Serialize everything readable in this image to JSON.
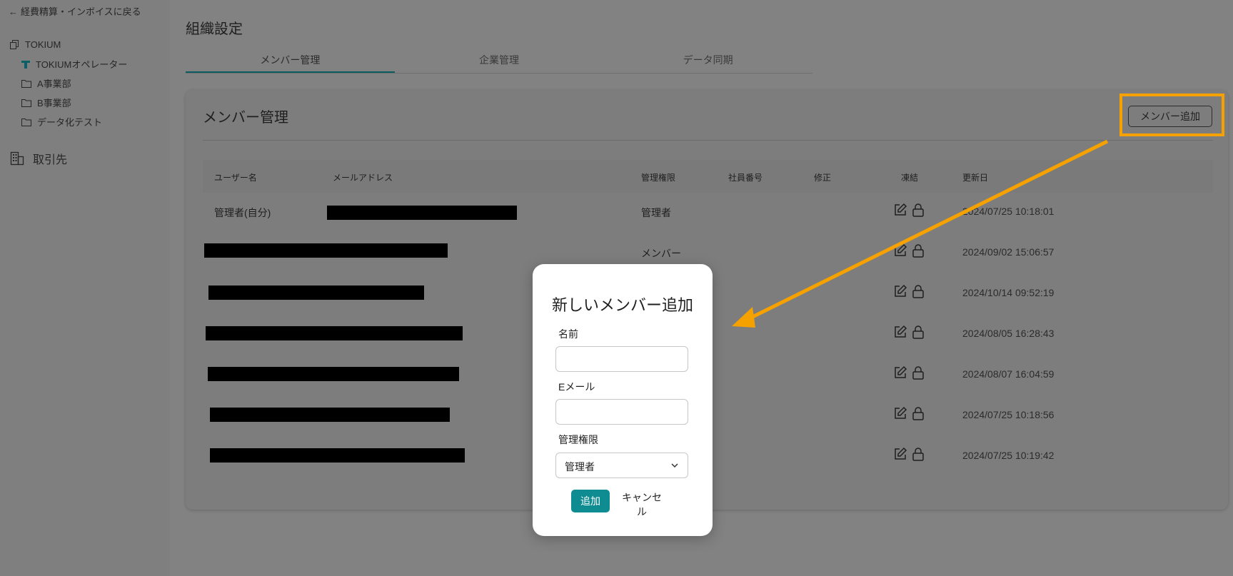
{
  "sidebar": {
    "back_link": "経費精算・インボイスに戻る",
    "org_root": "TOKIUM",
    "items": [
      {
        "label": "TOKIUMオペレーター"
      },
      {
        "label": "A事業部"
      },
      {
        "label": "B事業部"
      },
      {
        "label": "データ化テスト"
      }
    ],
    "vendor": "取引先"
  },
  "page": {
    "title": "組織設定",
    "tabs": [
      {
        "label": "メンバー管理",
        "active": true
      },
      {
        "label": "企業管理",
        "active": false
      },
      {
        "label": "データ同期",
        "active": false
      }
    ]
  },
  "card": {
    "title": "メンバー管理",
    "add_button": "メンバー追加",
    "columns": [
      "ユーザー名",
      "メールアドレス",
      "管理権限",
      "社員番号",
      "修正",
      "凍結",
      "更新日"
    ],
    "rows": [
      {
        "name": "管理者(自分)",
        "role": "管理者",
        "updated": "2024/07/25 10:18:01"
      },
      {
        "name": "",
        "role": "メンバー",
        "updated": "2024/09/02 15:06:57"
      },
      {
        "name": "",
        "role": "",
        "updated": "2024/10/14 09:52:19"
      },
      {
        "name": "",
        "role": "",
        "updated": "2024/08/05 16:28:43"
      },
      {
        "name": "",
        "role": "",
        "updated": "2024/08/07 16:04:59"
      },
      {
        "name": "",
        "role": "",
        "updated": "2024/07/25 10:18:56"
      },
      {
        "name": "",
        "role": "",
        "updated": "2024/07/25 10:19:42"
      }
    ]
  },
  "modal": {
    "title": "新しいメンバー追加",
    "name_label": "名前",
    "name_value": "",
    "email_label": "Eメール",
    "email_value": "",
    "role_label": "管理権限",
    "role_selected": "管理者",
    "add_button": "追加",
    "cancel_button": "キャンセル"
  },
  "colors": {
    "accent": "#0e8c92",
    "annotation": "#f5a200",
    "tab_active": "#0b5c61"
  }
}
